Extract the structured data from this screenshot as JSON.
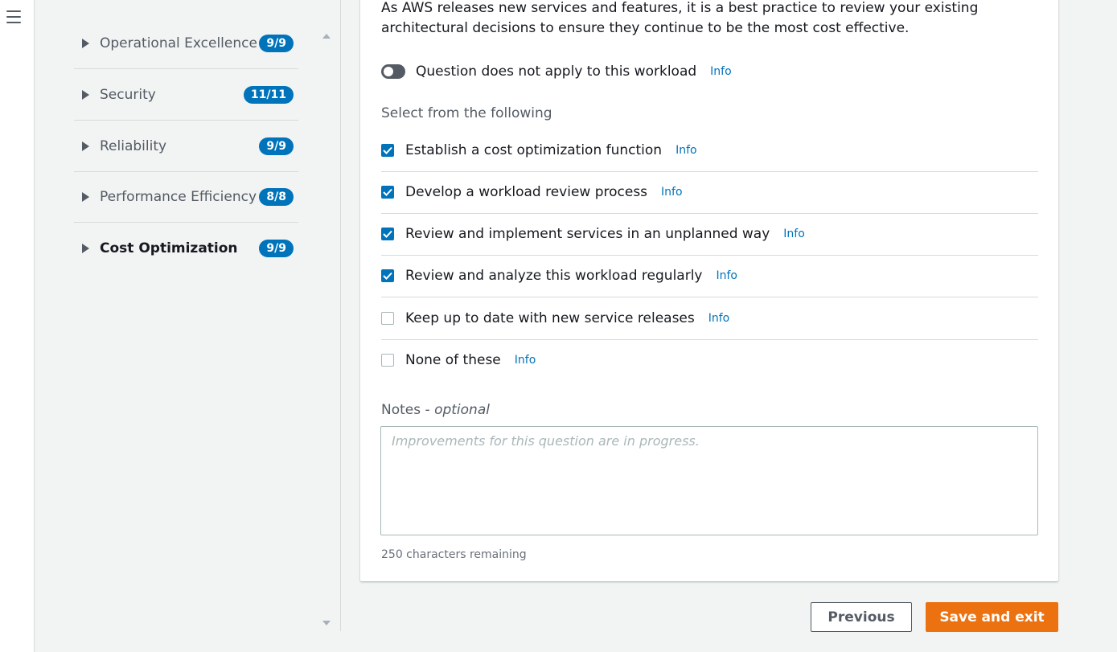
{
  "nav": {
    "pillars": [
      {
        "label": "Operational Excellence",
        "progress": "9/9"
      },
      {
        "label": "Security",
        "progress": "11/11"
      },
      {
        "label": "Reliability",
        "progress": "9/9"
      },
      {
        "label": "Performance Efficiency",
        "progress": "8/8"
      },
      {
        "label": "Cost Optimization",
        "progress": "9/9",
        "active": true
      }
    ]
  },
  "question": {
    "description": "As AWS releases new services and features, it is a best practice to review your existing architectural decisions to ensure they continue to be the most cost effective.",
    "not_applicable_label": "Question does not apply to this workload",
    "not_applicable_enabled": false,
    "info_label": "Info",
    "select_label": "Select from the following",
    "choices": [
      {
        "label": "Establish a cost optimization function",
        "checked": true
      },
      {
        "label": "Develop a workload review process",
        "checked": true
      },
      {
        "label": "Review and implement services in an unplanned way",
        "checked": true
      },
      {
        "label": "Review and analyze this workload regularly",
        "checked": true
      },
      {
        "label": "Keep up to date with new service releases",
        "checked": false
      },
      {
        "label": "None of these",
        "checked": false
      }
    ],
    "notes_label": "Notes",
    "notes_optional": "optional",
    "notes_placeholder": "Improvements for this question are in progress.",
    "notes_value": "",
    "chars_remaining": "250 characters remaining"
  },
  "actions": {
    "previous_label": "Previous",
    "save_exit_label": "Save and exit"
  },
  "colors": {
    "accent": "#0073bb",
    "primary_button": "#ec7211"
  }
}
